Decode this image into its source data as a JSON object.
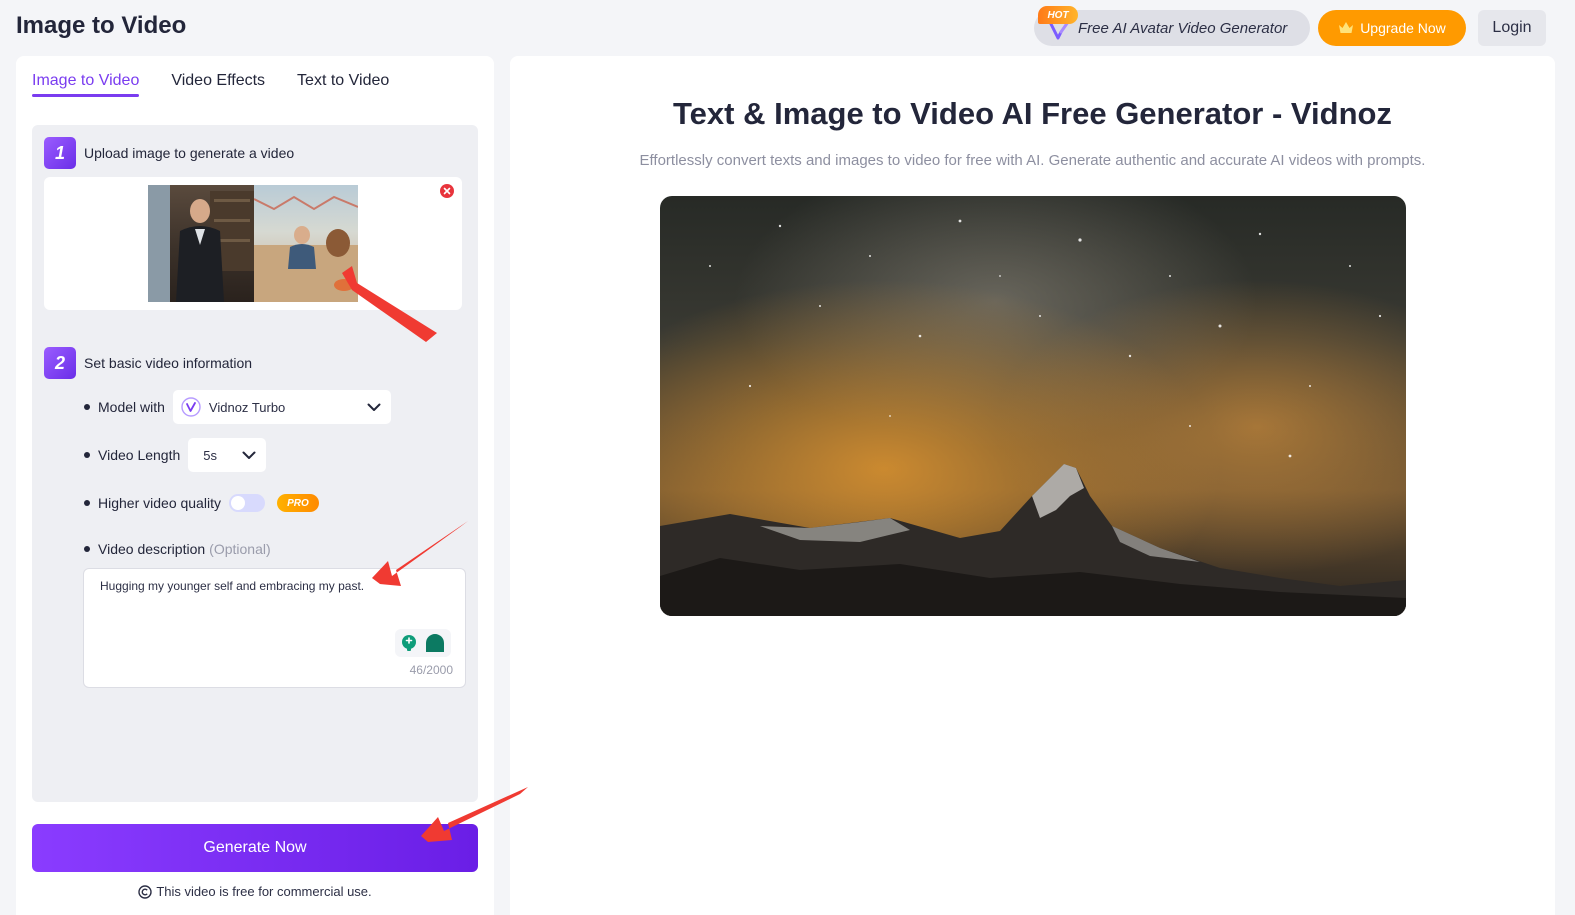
{
  "header": {
    "title": "Image to Video",
    "promo_badge": "HOT",
    "promo_label": "Free AI Avatar Video Generator",
    "upgrade_label": "Upgrade Now",
    "login_label": "Login"
  },
  "tabs": [
    {
      "label": "Image to Video",
      "active": true
    },
    {
      "label": "Video Effects",
      "active": false
    },
    {
      "label": "Text to Video",
      "active": false
    }
  ],
  "step1": {
    "number": "1",
    "label": "Upload image to generate a video"
  },
  "step2": {
    "number": "2",
    "label": "Set basic video information",
    "model_label": "Model with",
    "model_value": "Vidnoz Turbo",
    "length_label": "Video Length",
    "length_value": "5s",
    "quality_label": "Higher video quality",
    "quality_on": false,
    "pro_badge": "PRO",
    "desc_label": "Video description",
    "desc_optional": "(Optional)",
    "desc_value": "Hugging my younger self and embracing my past.",
    "char_count": "46/2000"
  },
  "generate_label": "Generate Now",
  "license_note": "This video is free for commercial use.",
  "hero": {
    "title": "Text & Image to Video AI Free Generator - Vidnoz",
    "subtitle": "Effortlessly convert texts and images to video for free with AI. Generate authentic and accurate AI videos with prompts."
  },
  "colors": {
    "accent": "#7a3cf0",
    "upgrade": "#ff9a00",
    "generate_start": "#8a3cff",
    "generate_end": "#6a1ee6",
    "annotation_arrow": "#f03a32"
  },
  "icons": [
    "vidnoz-logo-icon",
    "crown-icon",
    "delete-icon",
    "chevron-down-icon",
    "model-icon",
    "idea-icon",
    "chat-icon",
    "copyright-icon"
  ]
}
